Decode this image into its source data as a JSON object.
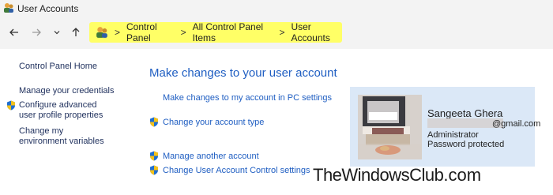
{
  "window": {
    "title": "User Accounts"
  },
  "nav": {
    "breadcrumbs": [
      {
        "label": "Control Panel"
      },
      {
        "label": "All Control Panel Items"
      },
      {
        "label": "User Accounts"
      }
    ],
    "separator": ">",
    "highlight_color": "#ffff66"
  },
  "sidebar": {
    "home": "Control Panel Home",
    "links": [
      "Manage your credentials",
      "Configure advanced user profile properties",
      "Change my environment variables"
    ]
  },
  "main": {
    "heading": "Make changes to your user account",
    "tasks": [
      "Make changes to my account in PC settings",
      "Change your account type",
      "Manage another account",
      "Change User Account Control settings"
    ]
  },
  "user": {
    "name": "Sangeeta Ghera",
    "email": "@gmail.com",
    "role": "Administrator",
    "status": "Password protected",
    "panel_color": "#dbe8f7"
  },
  "watermark": {
    "text": "TheWindowsClub",
    "suffix": ".com"
  },
  "colors": {
    "link": "#1f5ec2",
    "sidebar_link": "#1e2f5c"
  }
}
